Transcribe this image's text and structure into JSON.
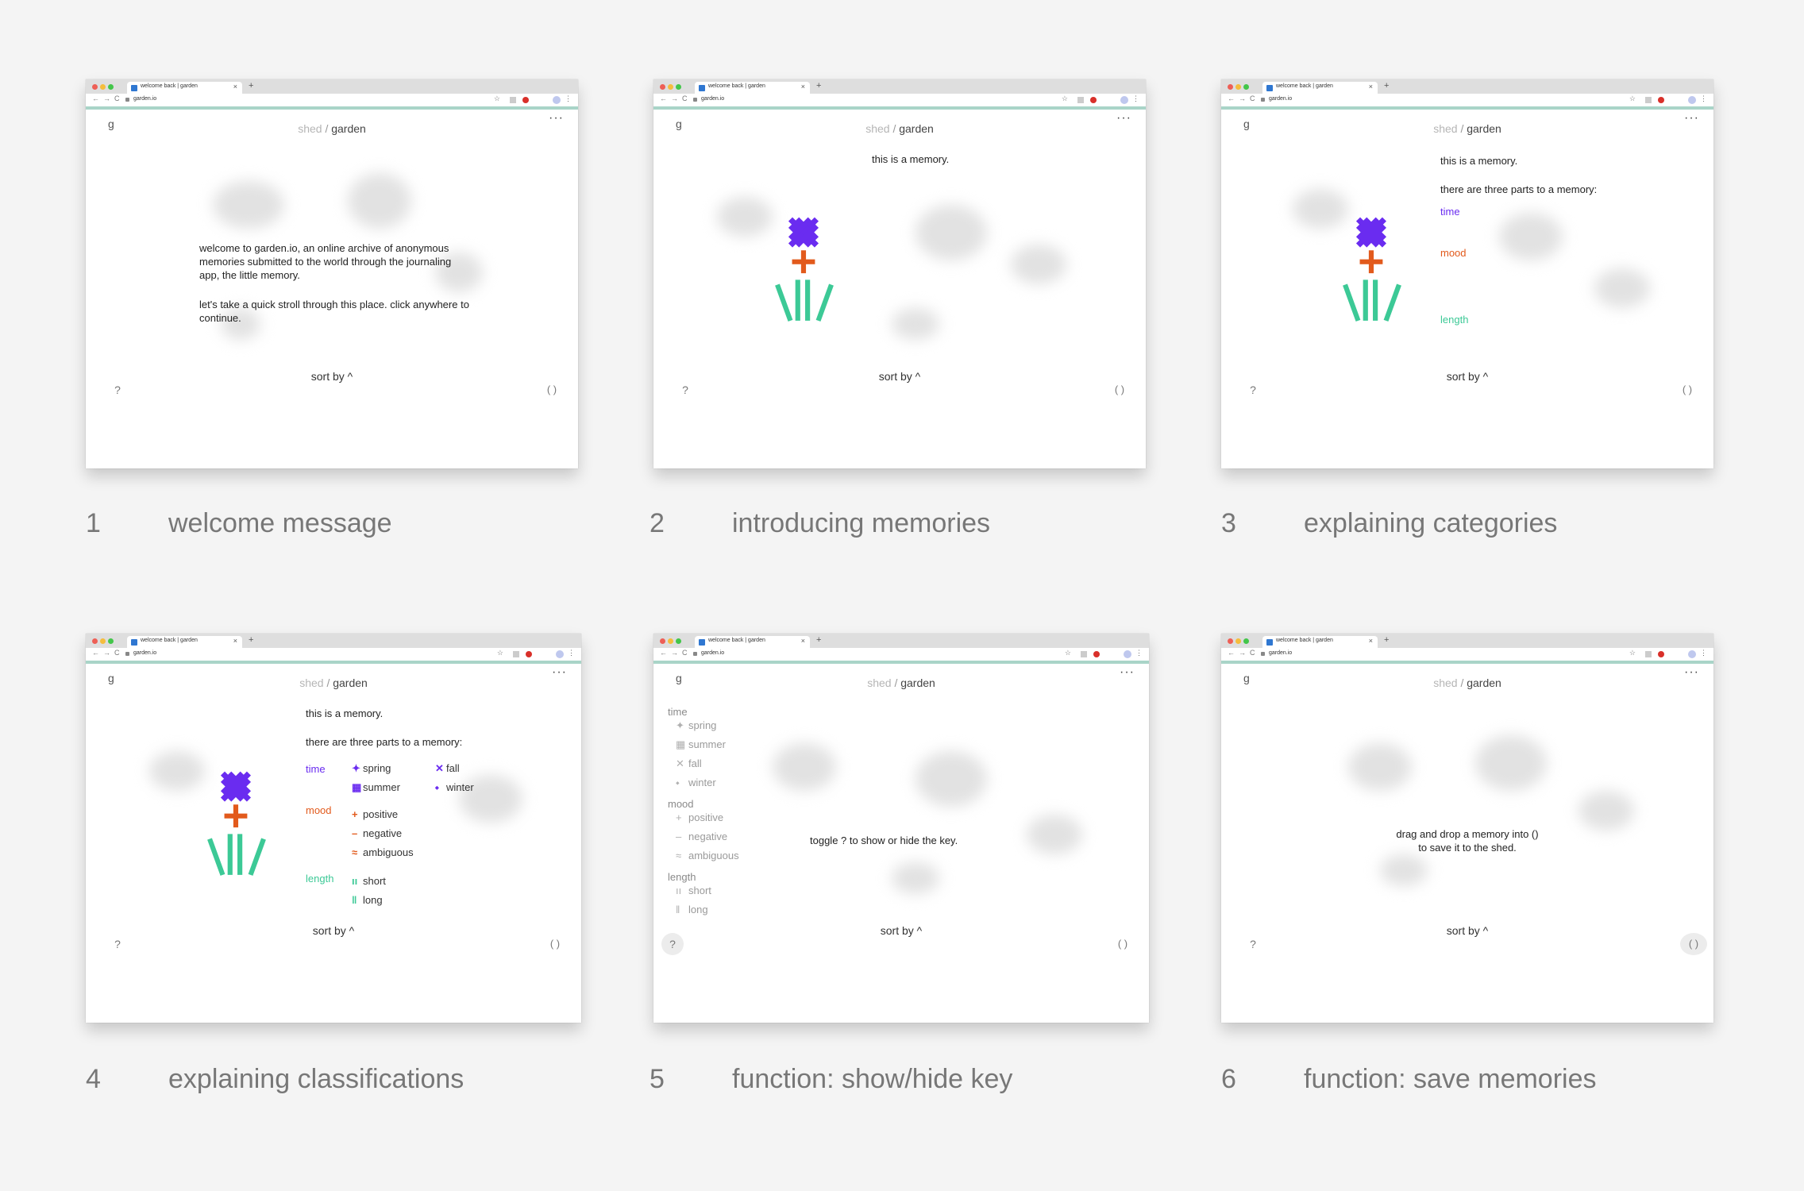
{
  "browser": {
    "tab_title": "welcome back | garden",
    "url": "garden.io",
    "close": "×",
    "new_tab": "+",
    "back": "←",
    "forward": "→",
    "reload": "C",
    "star": "☆",
    "menu": "⋮"
  },
  "app": {
    "logo": "g",
    "brand_shed": "shed",
    "brand_slash": "/",
    "brand_garden": "garden",
    "more": "···",
    "sort_by": "sort by ^",
    "help": "?",
    "save": "( )"
  },
  "colors": {
    "time": "#6a2cf0",
    "mood": "#e25a1c",
    "length": "#3cc996"
  },
  "frames": {
    "f1": {
      "number": "1",
      "caption": "welcome message",
      "text1": "welcome to garden.io, an online archive of anonymous memories submitted to the world through the journaling app, the little memory.",
      "text2": "let's take a quick stroll through this place. click anywhere to continue."
    },
    "f2": {
      "number": "2",
      "caption": "introducing memories",
      "text": "this is a memory."
    },
    "f3": {
      "number": "3",
      "caption": "explaining categories",
      "text1": "this is a memory.",
      "text2": "there are three parts to a memory:",
      "time": "time",
      "mood": "mood",
      "length": "length"
    },
    "f4": {
      "number": "4",
      "caption": "explaining classifications",
      "text1": "this is a memory.",
      "text2": "there are three parts to a memory:",
      "time": "time",
      "mood": "mood",
      "length": "length",
      "spring": "spring",
      "summer": "summer",
      "fall": "fall",
      "winter": "winter",
      "positive": "positive",
      "negative": "negative",
      "ambiguous": "ambiguous",
      "short": "short",
      "long": "long"
    },
    "f5": {
      "number": "5",
      "caption": "function: show/hide key",
      "key_time": "time",
      "spring": "spring",
      "summer": "summer",
      "fall": "fall",
      "winter": "winter",
      "key_mood": "mood",
      "positive": "positive",
      "negative": "negative",
      "ambiguous": "ambiguous",
      "key_length": "length",
      "short": "short",
      "long": "long",
      "text": "toggle ? to show or hide the key."
    },
    "f6": {
      "number": "6",
      "caption": "function: save memories",
      "text": "drag and drop a memory into () to save it to the shed."
    }
  }
}
